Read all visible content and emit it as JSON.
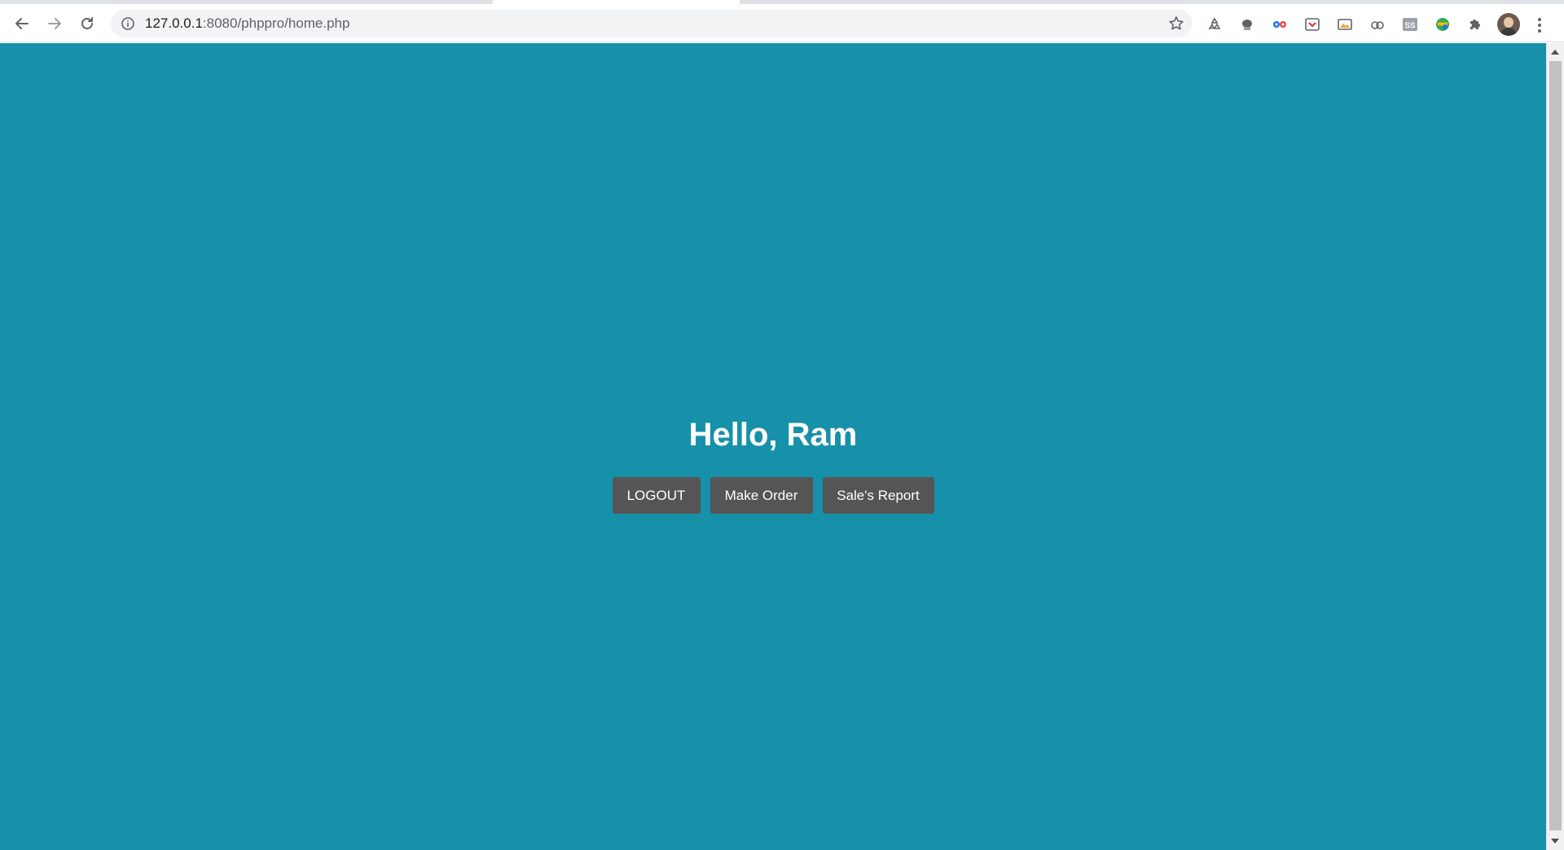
{
  "browser": {
    "url_host": "127.0.0.1",
    "url_rest": ":8080/phppro/home.php",
    "extensions": [
      "recycle-icon",
      "privacy-badger-icon",
      "eyes-extension-icon",
      "pocket-icon",
      "screen-cast-icon",
      "link-extension-icon",
      "ss-extension-icon",
      "globe-extension-icon",
      "puzzle-icon"
    ]
  },
  "page": {
    "background": "#1791a9",
    "greeting": "Hello, Ram",
    "buttons": {
      "logout": "LOGOUT",
      "make_order": "Make Order",
      "sales_report": "Sale's Report"
    },
    "button_color": "#555555"
  }
}
